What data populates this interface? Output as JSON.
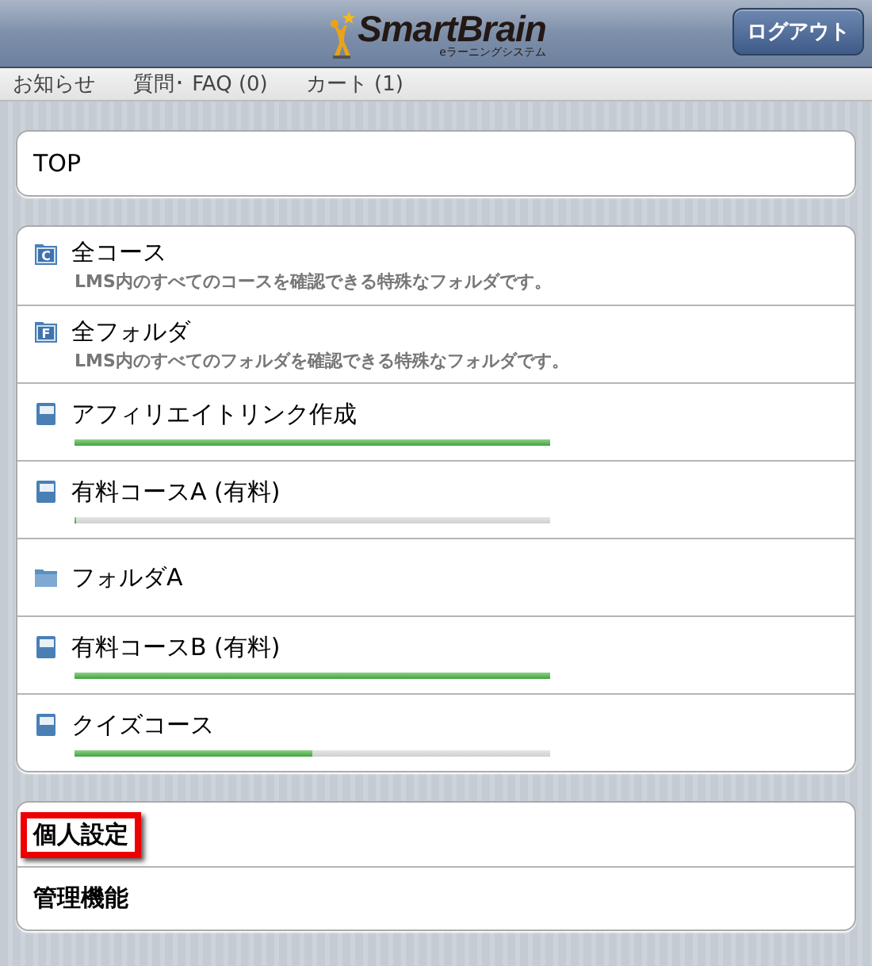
{
  "header": {
    "logo": {
      "name": "SmartBrain",
      "subtitle": "eラーニングシステム"
    },
    "logout_button": "ログアウト"
  },
  "nav": [
    "お知らせ",
    "質問･ FAQ (0)",
    "カート (1)"
  ],
  "top": {
    "label": "TOP"
  },
  "items": [
    {
      "kind": "special",
      "badge": "C",
      "title": "全コース",
      "description": "LMS内のすべてのコースを確認できる特殊なフォルダです。"
    },
    {
      "kind": "special",
      "badge": "F",
      "title": "全フォルダ",
      "description": "LMS内のすべてのフォルダを確認できる特殊なフォルダです。"
    },
    {
      "kind": "course",
      "title": "アフィリエイトリンク作成",
      "level": 1
    },
    {
      "kind": "course",
      "title": "有料コースA (有料)",
      "level": 0
    },
    {
      "kind": "folder",
      "title": "フォルダA"
    },
    {
      "kind": "course",
      "title": "有料コースB (有料)",
      "level": 1
    },
    {
      "kind": "course",
      "title": "クイズコース",
      "level": 0.5
    }
  ],
  "settings": [
    {
      "label": "個人設定",
      "highlighted": true
    },
    {
      "label": "管理機能",
      "highlighted": false
    }
  ]
}
